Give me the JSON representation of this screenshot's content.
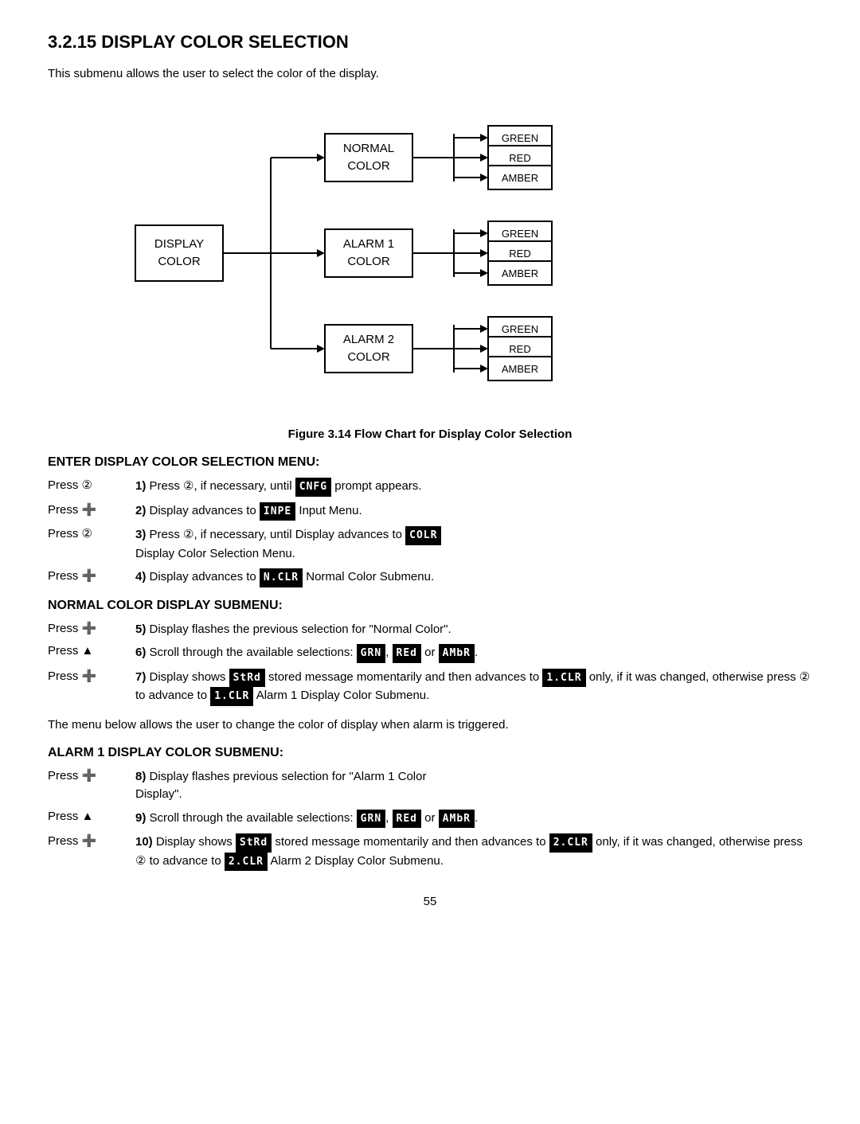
{
  "page": {
    "title": "3.2.15 DISPLAY COLOR SELECTION",
    "intro": "This submenu allows the user to select  the color of the display.",
    "figure_caption": "Figure 3.14 Flow Chart for Display Color Selection",
    "page_number": "55"
  },
  "flowchart": {
    "left_box": [
      "DISPLAY",
      "COLOR"
    ],
    "branches": [
      {
        "label": [
          "NORMAL",
          "COLOR"
        ],
        "options": [
          "GREEN",
          "RED",
          "AMBER"
        ]
      },
      {
        "label": [
          "ALARM 1",
          "COLOR"
        ],
        "options": [
          "GREEN",
          "RED",
          "AMBER"
        ]
      },
      {
        "label": [
          "ALARM 2",
          "COLOR"
        ],
        "options": [
          "GREEN",
          "RED",
          "AMBER"
        ]
      }
    ]
  },
  "sections": [
    {
      "id": "enter_display",
      "heading": "ENTER DISPLAY COLOR SELECTION MENU:",
      "steps": [
        {
          "press": "Press ⊙",
          "btn_type": "circle2",
          "number": "1)",
          "text": "Press ⊙, if necessary, until  prompt appears.",
          "lcd_items": [
            {
              "code": "CNFG",
              "position": "mid"
            }
          ]
        },
        {
          "press": "Press ⊕",
          "btn_type": "circle_plus",
          "number": "2)",
          "text": "Display advances to  Input Menu.",
          "lcd_items": [
            {
              "code": "INPE",
              "position": "mid"
            }
          ]
        },
        {
          "press": "Press ⊙",
          "btn_type": "circle2",
          "number": "3)",
          "text": "Press ⊙, if necessary, until Display advances to  Display Color Selection Menu.",
          "lcd_items": [
            {
              "code": "COLR",
              "position": "mid"
            }
          ]
        },
        {
          "press": "Press ⊕",
          "btn_type": "circle_plus",
          "number": "4)",
          "text": "Display advances to  Normal Color Submenu.",
          "lcd_items": [
            {
              "code": "N.CLR",
              "position": "mid"
            }
          ]
        }
      ]
    },
    {
      "id": "normal_color",
      "heading": "NORMAL COLOR DISPLAY SUBMENU:",
      "steps": [
        {
          "press": "Press ⊕",
          "number": "5)",
          "text": "Display flashes the previous selection for \"Normal Color\"."
        },
        {
          "press": "Press ▲",
          "number": "6)",
          "text": "Scroll through the available selections: GRN, REd or AMbR.",
          "lcd_multi": [
            "GRN",
            "REd",
            "AMbR"
          ]
        },
        {
          "press": "Press ⊕",
          "number": "7)",
          "text": "Display shows StRd stored message momentarily and then advances to 1.CLR only, if it was changed, otherwise press ⊙ to advance to 1.CLR Alarm 1 Display Color Submenu.",
          "lcd_multi2": [
            "StRd",
            "1.CLR",
            "1.CLR"
          ]
        }
      ]
    },
    {
      "id": "paragraph1",
      "type": "paragraph",
      "text": "The menu below allows the user to change the color of display when alarm is triggered."
    },
    {
      "id": "alarm1_color",
      "heading": "ALARM 1 DISPLAY COLOR SUBMENU:",
      "steps": [
        {
          "press": "Press ⊕",
          "number": "8)",
          "text": "Display flashes previous selection for \"Alarm 1 Color Display\"."
        },
        {
          "press": "Press ▲",
          "number": "9)",
          "text": "Scroll through the available selections: GRN, REd or AMbR.",
          "lcd_multi": [
            "GRN",
            "REd",
            "AMbR"
          ]
        },
        {
          "press": "Press ⊕",
          "number": "10)",
          "text": "Display shows StRd stored message momentarily and then advances to 2.CLR only, if it was changed, otherwise press ⊙ to advance to 2.CLR Alarm 2 Display Color Submenu.",
          "lcd_multi2": [
            "StRd",
            "2.CLR",
            "2.CLR"
          ]
        }
      ]
    }
  ]
}
